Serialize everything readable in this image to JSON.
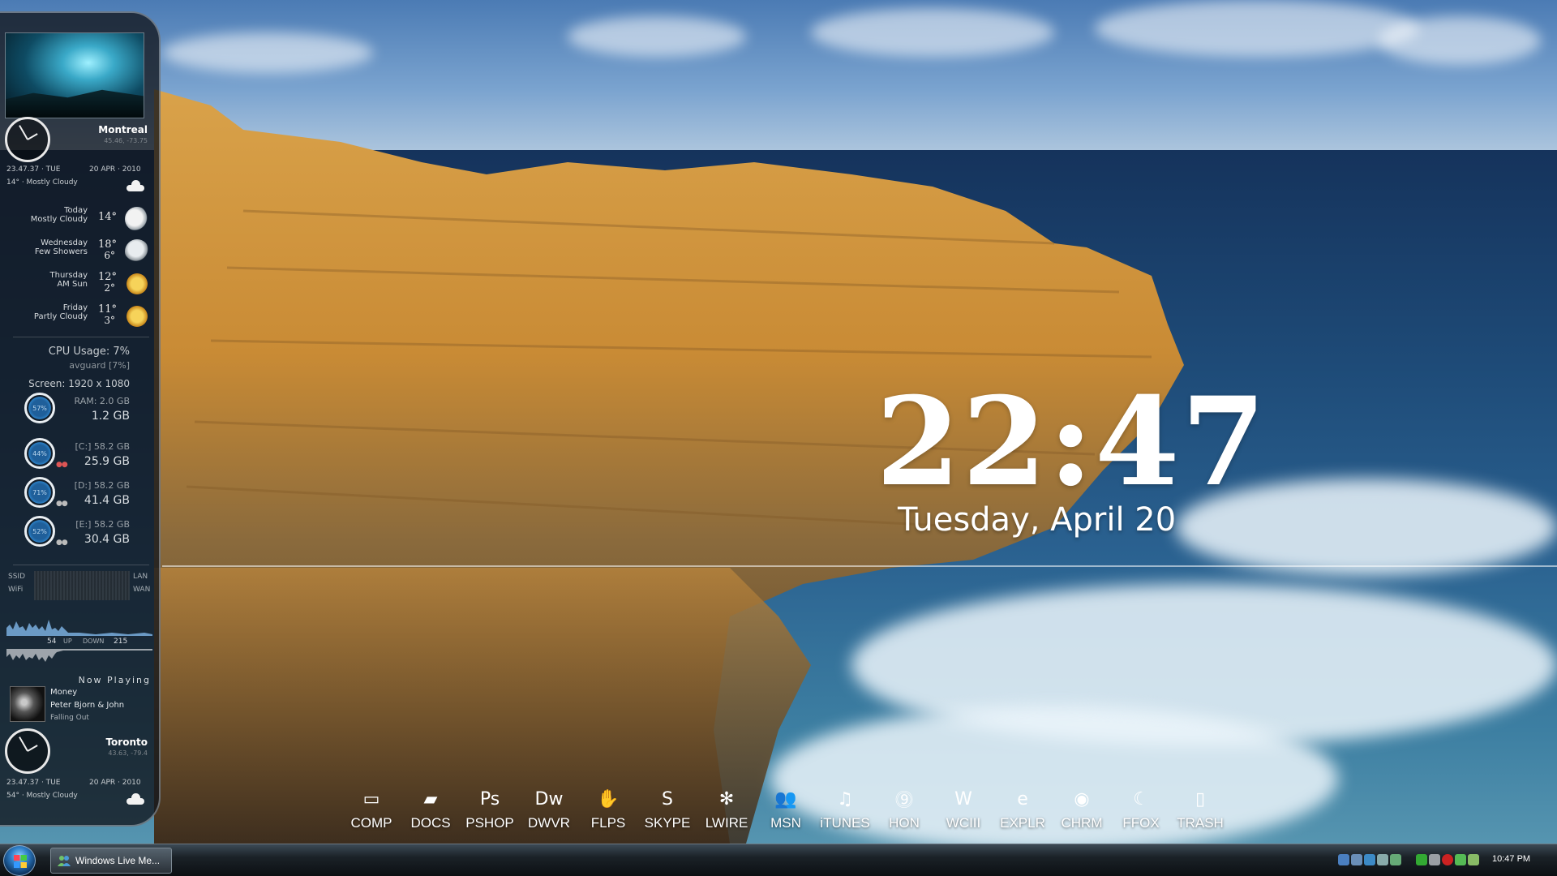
{
  "sidebar": {
    "montreal": {
      "city": "Montreal",
      "coords": "45.46, -73.75",
      "time": "23.47.37 · TUE",
      "date": "20 APR · 2010",
      "condition": "14° · Mostly Cloudy"
    },
    "forecast": [
      {
        "day": "Today",
        "desc": "Mostly Cloudy",
        "hi": "14°",
        "lo": "",
        "icon": "cloudy-icon"
      },
      {
        "day": "Wednesday",
        "desc": "Few Showers",
        "hi": "18°",
        "lo": "6°",
        "icon": "showers-icon"
      },
      {
        "day": "Thursday",
        "desc": "AM Sun",
        "hi": "12°",
        "lo": "2°",
        "icon": "sun-icon"
      },
      {
        "day": "Friday",
        "desc": "Partly Cloudy",
        "hi": "11°",
        "lo": "3°",
        "icon": "partly-cloudy-icon"
      }
    ],
    "system": {
      "cpu": "CPU Usage:   7%",
      "process": "avguard [7%]",
      "screen": "Screen:  1920 x 1080",
      "ram_label": "RAM: 2.0 GB",
      "ram_used": "1.2 GB",
      "ram_pct": "57%",
      "drives": [
        {
          "label": "[C:] 58.2 GB",
          "free": "25.9 GB",
          "pct": "44%"
        },
        {
          "label": "[D:] 58.2 GB",
          "free": "41.4 GB",
          "pct": "71%"
        },
        {
          "label": "[E:] 58.2 GB",
          "free": "30.4 GB",
          "pct": "52%"
        }
      ]
    },
    "network": {
      "ssid": "SSID",
      "wifi": "WiFi",
      "lan": "LAN",
      "wan": "WAN",
      "up_value": "54",
      "up_label": "UP",
      "down_label": "DOWN",
      "down_value": "215"
    },
    "now_playing": {
      "title": "Now Playing",
      "song": "Money",
      "artist": "Peter Bjorn & John",
      "album": "Falling Out"
    },
    "toronto": {
      "city": "Toronto",
      "coords": "43.63, -79.4",
      "time": "23.47.37 · TUE",
      "date": "20 APR · 2010",
      "condition": "54° · Mostly Cloudy"
    }
  },
  "clock": {
    "time": "22:47",
    "date": "Tuesday, April 20"
  },
  "dock": [
    {
      "label": "COMP",
      "icon": "monitor-icon",
      "glyph": "▭"
    },
    {
      "label": "DOCS",
      "icon": "folder-icon",
      "glyph": "▰"
    },
    {
      "label": "PSHOP",
      "icon": "photoshop-icon",
      "glyph": "Ps"
    },
    {
      "label": "DWVR",
      "icon": "dreamweaver-icon",
      "glyph": "Dw"
    },
    {
      "label": "FLPS",
      "icon": "flps-icon",
      "glyph": "✋"
    },
    {
      "label": "SKYPE",
      "icon": "skype-icon",
      "glyph": "S"
    },
    {
      "label": "LWIRE",
      "icon": "limewire-icon",
      "glyph": "✻"
    },
    {
      "label": "MSN",
      "icon": "msn-icon",
      "glyph": "👥"
    },
    {
      "label": "iTUNES",
      "icon": "itunes-icon",
      "glyph": "♫"
    },
    {
      "label": "HON",
      "icon": "hon-icon",
      "glyph": "⓽"
    },
    {
      "label": "WCIII",
      "icon": "warcraft-icon",
      "glyph": "W"
    },
    {
      "label": "EXPLR",
      "icon": "ie-icon",
      "glyph": "e"
    },
    {
      "label": "CHRM",
      "icon": "chrome-icon",
      "glyph": "◉"
    },
    {
      "label": "FFOX",
      "icon": "firefox-icon",
      "glyph": "☾"
    },
    {
      "label": "TRASH",
      "icon": "trash-icon",
      "glyph": "▯"
    }
  ],
  "taskbar": {
    "task": "Windows Live Me...",
    "time": "10:47 PM"
  }
}
